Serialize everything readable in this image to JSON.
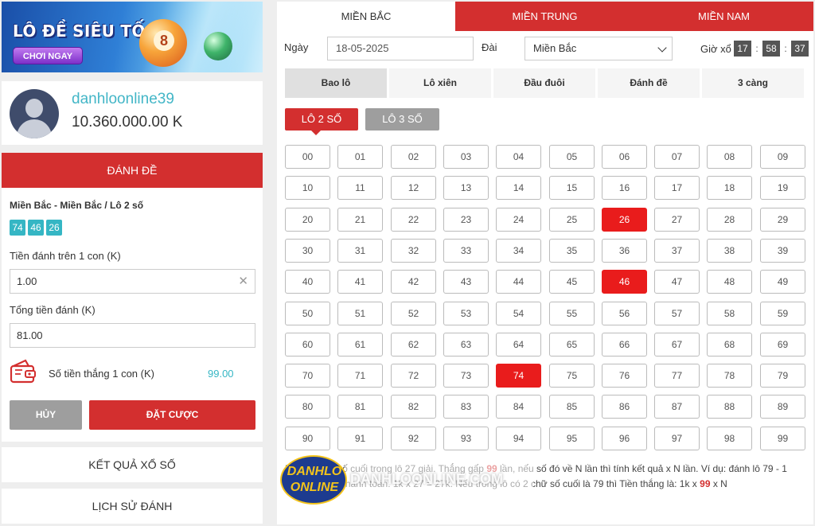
{
  "banner": {
    "title": "LÔ ĐỀ SIÊU TỐC",
    "button": "CHƠI NGAY",
    "ball_number": "8"
  },
  "profile": {
    "username": "danhloonline39",
    "balance": "10.360.000.00 K"
  },
  "bet": {
    "header": "ĐÁNH ĐỀ",
    "path": "Miền Bắc - Miền Bắc / Lô 2 số",
    "chips": [
      "74",
      "46",
      "26"
    ],
    "stake_label": "Tiền đánh trên 1 con (K)",
    "stake_value": "1.00",
    "total_label": "Tổng tiền đánh (K)",
    "total_value": "81.00",
    "win_label": "Số tiền thắng 1 con (K)",
    "win_value": "99.00",
    "cancel": "HỦY",
    "submit": "ĐẶT CƯỢC"
  },
  "links": {
    "results": "KẾT QUẢ XỔ SỐ",
    "history": "LỊCH SỬ ĐÁNH"
  },
  "tabs": [
    "MIỀN BẮC",
    "MIỀN TRUNG",
    "MIỀN NAM"
  ],
  "filters": {
    "date_label": "Ngày",
    "date_value": "18-05-2025",
    "station_label": "Đài",
    "station_value": "Miền Bắc",
    "time_label": "Giờ xổ",
    "time": [
      "17",
      "58",
      "37"
    ],
    "time_sep": ":"
  },
  "subtabs": [
    "Bao lô",
    "Lô xiên",
    "Đầu đuôi",
    "Đánh đề",
    "3 càng"
  ],
  "modes": [
    "LÔ 2 SỐ",
    "LÔ 3 SỐ"
  ],
  "selected_numbers": [
    "26",
    "46",
    "74"
  ],
  "description": {
    "p1": "Đánh 2 chữ số cuối trong lô 27 giải. Thắng gấp ",
    "n1": "99",
    "p2": " lần, nếu số đó về N lần thì tính kết quả x N lần. Ví dụ: đánh lô 79 - 1 con 1k, Tổng thanh toán: 1k x 27 = 27k. Nếu trong lô có 2 chữ số cuối là 79 thì Tiền thắng là: 1k x ",
    "n2": "99",
    "p3": " x N"
  },
  "watermark": {
    "badge_top": "DANHLO",
    "badge_bottom": "ONLINE",
    "text": "DANHLOONLINE.COM"
  },
  "colors": {
    "accent_red": "#d32f2f",
    "selected_red": "#e91c1c",
    "teal": "#35b6c4",
    "grey_button": "#9e9e9e"
  }
}
